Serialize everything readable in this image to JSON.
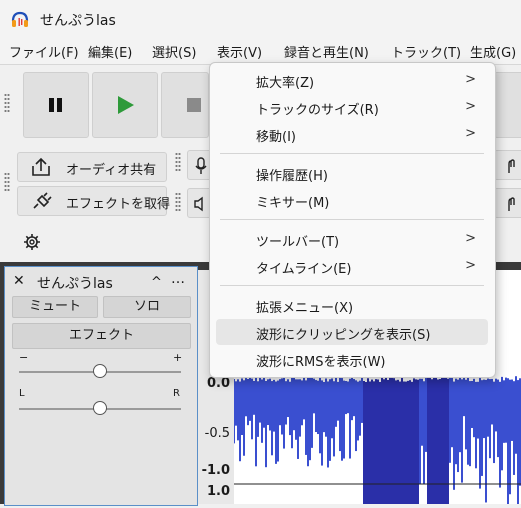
{
  "window": {
    "title": "せんぷうlas"
  },
  "menubar": [
    {
      "label": "ファイル(F)"
    },
    {
      "label": "編集(E)"
    },
    {
      "label": "選択(S)"
    },
    {
      "label": "表示(V)"
    },
    {
      "label": "録音と再生(N)"
    },
    {
      "label": "トラック(T)"
    },
    {
      "label": "生成(G)"
    }
  ],
  "toolbar": {
    "share_audio": "オーディオ共有",
    "get_effects": "エフェクトを取得"
  },
  "view_menu": {
    "items": [
      {
        "label": "拡大率(Z)",
        "submenu": true
      },
      {
        "label": "トラックのサイズ(R)",
        "submenu": true
      },
      {
        "label": "移動(I)",
        "submenu": true
      },
      {
        "label": "操作履歴(H)",
        "submenu": false
      },
      {
        "label": "ミキサー(M)",
        "submenu": false
      },
      {
        "label": "ツールバー(T)",
        "submenu": true
      },
      {
        "label": "タイムライン(E)",
        "submenu": true
      },
      {
        "label": "拡張メニュー(X)",
        "submenu": false
      },
      {
        "label": "波形にクリッピングを表示(S)",
        "submenu": false,
        "highlighted": true
      },
      {
        "label": "波形にRMSを表示(W)",
        "submenu": false
      }
    ],
    "arrow_glyph": ">"
  },
  "track": {
    "name": "せんぷうlas",
    "close_glyph": "✕",
    "collapse_glyph": "^",
    "more_glyph": "…",
    "mute": "ミュート",
    "solo": "ソロ",
    "effects": "エフェクト",
    "gain_min": "−",
    "gain_max": "+",
    "pan_left": "L",
    "pan_right": "R",
    "gain_value": 0.5,
    "pan_value": 0.5
  },
  "ruler": {
    "labels": [
      "0.0",
      "-0.5",
      "-1.0",
      "1.0"
    ]
  },
  "colors": {
    "waveform": "#3a4fd0",
    "waveform_dark": "#2a2fa8",
    "accent": "#5a8fc8"
  }
}
